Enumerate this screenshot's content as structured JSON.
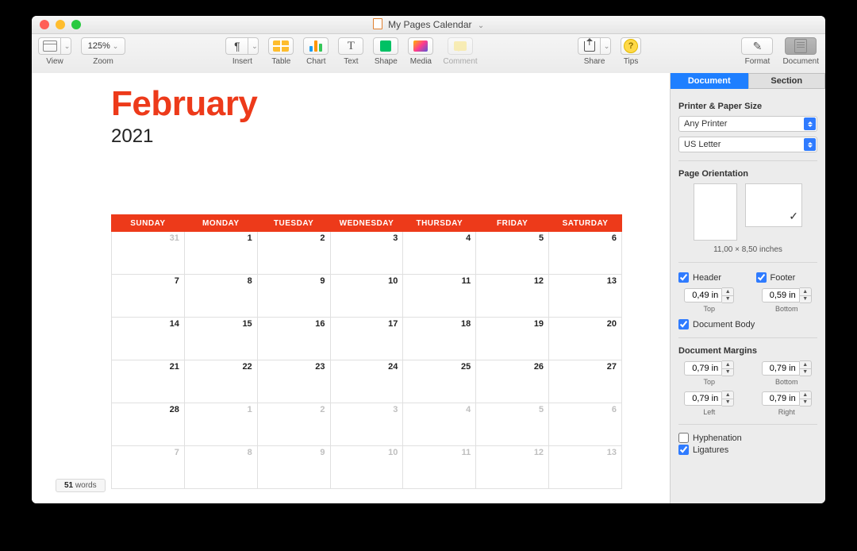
{
  "window": {
    "title": "My Pages Calendar"
  },
  "toolbar": {
    "view_label": "View",
    "zoom_value": "125%",
    "zoom_label": "Zoom",
    "insert_label": "Insert",
    "table_label": "Table",
    "chart_label": "Chart",
    "text_label": "Text",
    "shape_label": "Shape",
    "media_label": "Media",
    "comment_label": "Comment",
    "share_label": "Share",
    "tips_label": "Tips",
    "format_label": "Format",
    "document_label": "Document"
  },
  "page": {
    "month": "February",
    "year": "2021"
  },
  "calendar": {
    "headers": [
      "SUNDAY",
      "MONDAY",
      "TUESDAY",
      "WEDNESDAY",
      "THURSDAY",
      "FRIDAY",
      "SATURDAY"
    ],
    "weeks": [
      [
        {
          "d": "31",
          "other": true
        },
        {
          "d": "1"
        },
        {
          "d": "2"
        },
        {
          "d": "3"
        },
        {
          "d": "4"
        },
        {
          "d": "5"
        },
        {
          "d": "6"
        }
      ],
      [
        {
          "d": "7"
        },
        {
          "d": "8"
        },
        {
          "d": "9"
        },
        {
          "d": "10"
        },
        {
          "d": "11"
        },
        {
          "d": "12"
        },
        {
          "d": "13"
        }
      ],
      [
        {
          "d": "14"
        },
        {
          "d": "15"
        },
        {
          "d": "16"
        },
        {
          "d": "17"
        },
        {
          "d": "18"
        },
        {
          "d": "19"
        },
        {
          "d": "20"
        }
      ],
      [
        {
          "d": "21"
        },
        {
          "d": "22"
        },
        {
          "d": "23"
        },
        {
          "d": "24"
        },
        {
          "d": "25"
        },
        {
          "d": "26"
        },
        {
          "d": "27"
        }
      ],
      [
        {
          "d": "28"
        },
        {
          "d": "1",
          "other": true
        },
        {
          "d": "2",
          "other": true
        },
        {
          "d": "3",
          "other": true
        },
        {
          "d": "4",
          "other": true
        },
        {
          "d": "5",
          "other": true
        },
        {
          "d": "6",
          "other": true
        }
      ],
      [
        {
          "d": "7",
          "other": true
        },
        {
          "d": "8",
          "other": true
        },
        {
          "d": "9",
          "other": true
        },
        {
          "d": "10",
          "other": true
        },
        {
          "d": "11",
          "other": true
        },
        {
          "d": "12",
          "other": true
        },
        {
          "d": "13",
          "other": true
        }
      ]
    ]
  },
  "wordcount": {
    "count": "51",
    "unit": "words"
  },
  "inspector": {
    "tabs": {
      "document": "Document",
      "section": "Section"
    },
    "printer": {
      "heading": "Printer & Paper Size",
      "printer_value": "Any Printer",
      "paper_value": "US Letter"
    },
    "orientation": {
      "heading": "Page Orientation",
      "selected": "landscape",
      "size_text": "11,00 × 8,50 inches"
    },
    "header_footer": {
      "header_label": "Header",
      "footer_label": "Footer",
      "header_checked": true,
      "footer_checked": true,
      "top_value": "0,49 in",
      "top_label": "Top",
      "bottom_value": "0,59 in",
      "bottom_label": "Bottom"
    },
    "document_body": {
      "label": "Document Body",
      "checked": true
    },
    "margins": {
      "heading": "Document Margins",
      "top_value": "0,79 in",
      "top_label": "Top",
      "bottom_value": "0,79 in",
      "bottom_label": "Bottom",
      "left_value": "0,79 in",
      "left_label": "Left",
      "right_value": "0,79 in",
      "right_label": "Right"
    },
    "hyphenation": {
      "label": "Hyphenation",
      "checked": false
    },
    "ligatures": {
      "label": "Ligatures",
      "checked": true
    }
  }
}
